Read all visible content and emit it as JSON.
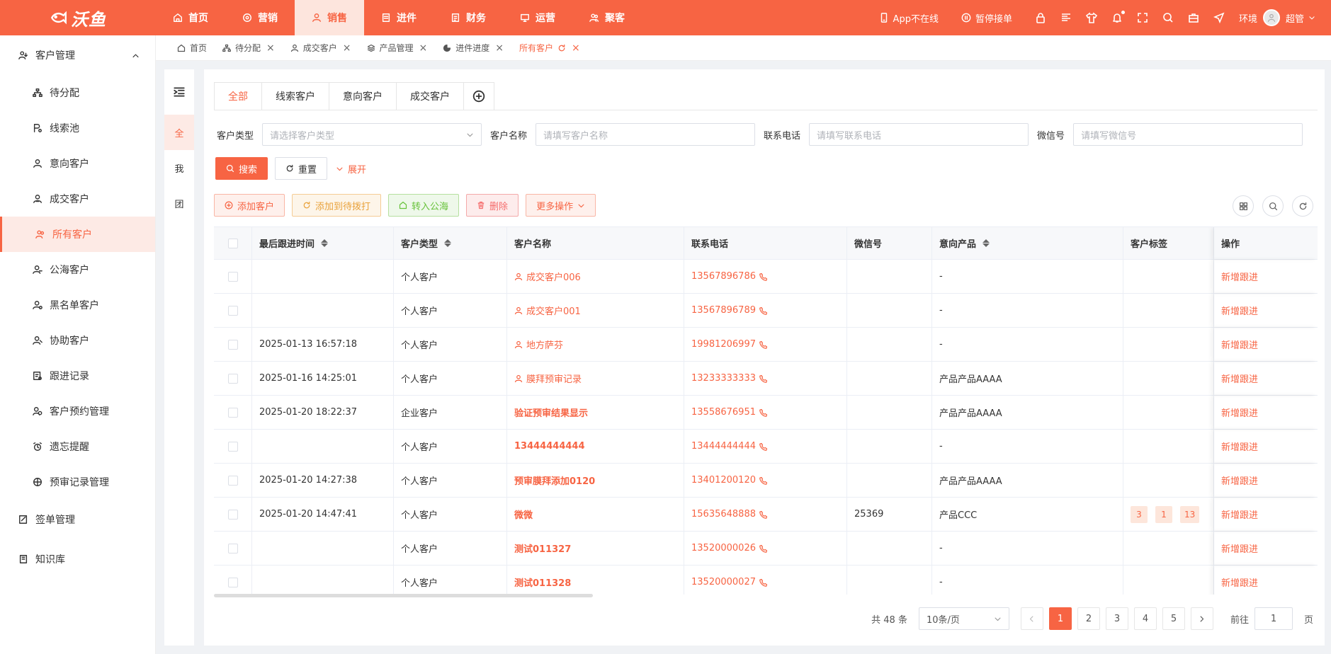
{
  "brand": {
    "logo_text": "沃鱼"
  },
  "topnav": [
    {
      "label": "首页",
      "icon": "home-icon"
    },
    {
      "label": "营销",
      "icon": "target-icon"
    },
    {
      "label": "销售",
      "icon": "user-icon",
      "active": true
    },
    {
      "label": "进件",
      "icon": "document-icon"
    },
    {
      "label": "财务",
      "icon": "ledger-icon"
    },
    {
      "label": "运营",
      "icon": "monitor-icon"
    },
    {
      "label": "聚客",
      "icon": "users-icon"
    }
  ],
  "topright": {
    "app_status": "App不在线",
    "pause_label": "暂停接单",
    "env_label": "环境",
    "user_name": "超管"
  },
  "sidebar": {
    "group_customer": "客户管理",
    "items": [
      {
        "label": "待分配",
        "icon": "org-icon"
      },
      {
        "label": "线索池",
        "icon": "clue-icon"
      },
      {
        "label": "意向客户",
        "icon": "user-icon"
      },
      {
        "label": "成交客户",
        "icon": "user-check-icon"
      },
      {
        "label": "所有客户",
        "icon": "users-icon",
        "active": true
      },
      {
        "label": "公海客户",
        "icon": "user-sea-icon"
      },
      {
        "label": "黑名单客户",
        "icon": "user-block-icon"
      },
      {
        "label": "协助客户",
        "icon": "user-assist-icon"
      },
      {
        "label": "跟进记录",
        "icon": "record-icon"
      },
      {
        "label": "客户预约管理",
        "icon": "appointment-icon"
      },
      {
        "label": "遗忘提醒",
        "icon": "alarm-icon"
      },
      {
        "label": "预审记录管理",
        "icon": "audit-icon"
      }
    ],
    "group_contract": "签单管理",
    "group_knowledge": "知识库"
  },
  "tabs": [
    {
      "label": "首页",
      "icon": "home-icon",
      "closable": false
    },
    {
      "label": "待分配",
      "icon": "org-icon",
      "closable": true
    },
    {
      "label": "成交客户",
      "icon": "user-check-icon",
      "closable": true
    },
    {
      "label": "产品管理",
      "icon": "layers-icon",
      "closable": true
    },
    {
      "label": "进件进度",
      "icon": "pie-icon",
      "closable": true
    },
    {
      "label": "所有客户",
      "icon": "",
      "closable": true,
      "active": true
    }
  ],
  "mini_panel": [
    "全",
    "我",
    "团"
  ],
  "customer_type_tabs": [
    "全部",
    "线索客户",
    "意向客户",
    "成交客户"
  ],
  "filters": {
    "type_label": "客户类型",
    "type_placeholder": "请选择客户类型",
    "name_label": "客户名称",
    "name_placeholder": "请填写客户名称",
    "phone_label": "联系电话",
    "phone_placeholder": "请填写联系电话",
    "wechat_label": "微信号",
    "wechat_placeholder": "请填写微信号"
  },
  "buttons": {
    "search": "搜索",
    "reset": "重置",
    "expand": "展开",
    "add_customer": "添加客户",
    "add_to_dial": "添加到待拨打",
    "to_public": "转入公海",
    "delete": "删除",
    "more": "更多操作"
  },
  "table": {
    "headers": [
      "最后跟进时间",
      "客户类型",
      "客户名称",
      "联系电话",
      "微信号",
      "意向产品",
      "客户标签",
      "操作"
    ],
    "rows": [
      {
        "time": "",
        "type": "个人客户",
        "name": "成交客户006",
        "name_icon": true,
        "phone": "13567896786",
        "wechat": "",
        "product": "-",
        "tags": [],
        "action": "新增跟进"
      },
      {
        "time": "",
        "type": "个人客户",
        "name": "成交客户001",
        "name_icon": true,
        "phone": "13567896789",
        "wechat": "",
        "product": "-",
        "tags": [],
        "action": "新增跟进"
      },
      {
        "time": "2025-01-13 16:57:18",
        "type": "个人客户",
        "name": "地方萨芬",
        "name_icon": true,
        "phone": "19981206997",
        "wechat": "",
        "product": "-",
        "tags": [],
        "action": "新增跟进"
      },
      {
        "time": "2025-01-16 14:25:01",
        "type": "个人客户",
        "name": "膜拜预审记录",
        "name_icon": true,
        "phone": "13233333333",
        "wechat": "",
        "product": "产品产品AAAA",
        "tags": [],
        "action": "新增跟进"
      },
      {
        "time": "2025-01-20 18:22:37",
        "type": "企业客户",
        "name": "验证预审结果显示",
        "name_icon": false,
        "phone": "13558676951",
        "wechat": "",
        "product": "产品产品AAAA",
        "tags": [],
        "action": "新增跟进"
      },
      {
        "time": "",
        "type": "个人客户",
        "name": "13444444444",
        "name_icon": false,
        "phone": "13444444444",
        "wechat": "",
        "product": "-",
        "tags": [],
        "action": "新增跟进"
      },
      {
        "time": "2025-01-20 14:27:38",
        "type": "个人客户",
        "name": "预审膜拜添加0120",
        "name_icon": false,
        "phone": "13401200120",
        "wechat": "",
        "product": "产品产品AAAA",
        "tags": [],
        "action": "新增跟进"
      },
      {
        "time": "2025-01-20 14:47:41",
        "type": "个人客户",
        "name": "微微",
        "name_icon": false,
        "phone": "15635648888",
        "wechat": "25369",
        "product": "产品CCC",
        "tags": [
          "3",
          "1",
          "13"
        ],
        "action": "新增跟进"
      },
      {
        "time": "",
        "type": "个人客户",
        "name": "测试011327",
        "name_icon": false,
        "phone": "13520000026",
        "wechat": "",
        "product": "-",
        "tags": [],
        "action": "新增跟进"
      },
      {
        "time": "",
        "type": "个人客户",
        "name": "测试011328",
        "name_icon": false,
        "phone": "13520000027",
        "wechat": "",
        "product": "-",
        "tags": [],
        "action": "新增跟进"
      }
    ]
  },
  "pagination": {
    "total": "共 48 条",
    "page_size": "10条/页",
    "pages": [
      "1",
      "2",
      "3",
      "4",
      "5"
    ],
    "current": "1",
    "goto_prefix": "前往",
    "goto_value": "1",
    "goto_suffix": "页"
  },
  "colors": {
    "accent": "#f76443"
  }
}
